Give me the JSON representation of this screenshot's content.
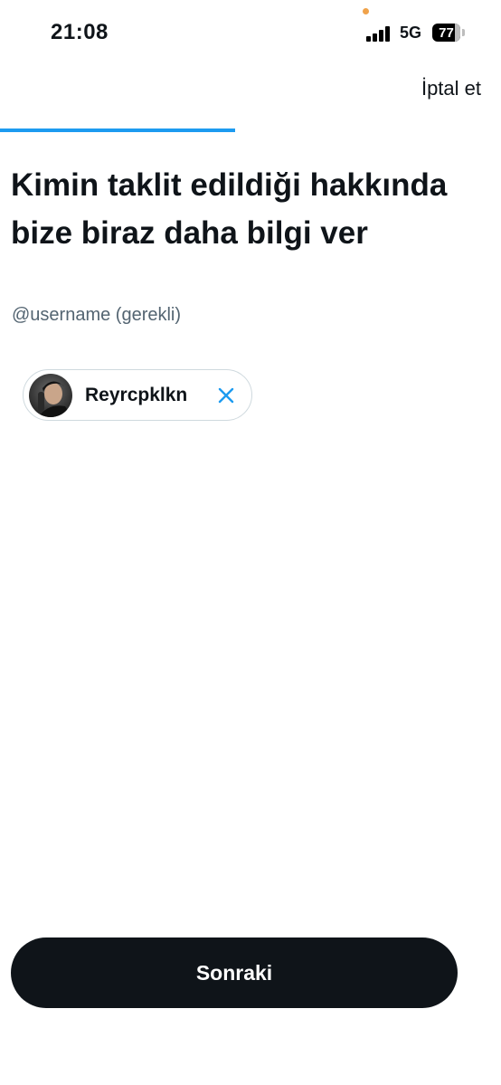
{
  "status_bar": {
    "time": "21:08",
    "network": "5G",
    "battery": "77",
    "signal_icon": "cellular-signal-icon",
    "battery_icon": "battery-icon"
  },
  "header": {
    "cancel_label": "İptal et"
  },
  "progress": {
    "fraction": 0.47,
    "color": "#1d9bf0"
  },
  "main": {
    "title": "Kimin taklit edildiği hakkında bize biraz daha bilgi ver",
    "subtitle": "@username (gerekli)",
    "selected_account": {
      "name": "Reyrcpklkn",
      "avatar_icon": "profile-photo",
      "remove_icon": "close-icon",
      "remove_color": "#1d9bf0"
    }
  },
  "footer": {
    "next_label": "Sonraki"
  }
}
